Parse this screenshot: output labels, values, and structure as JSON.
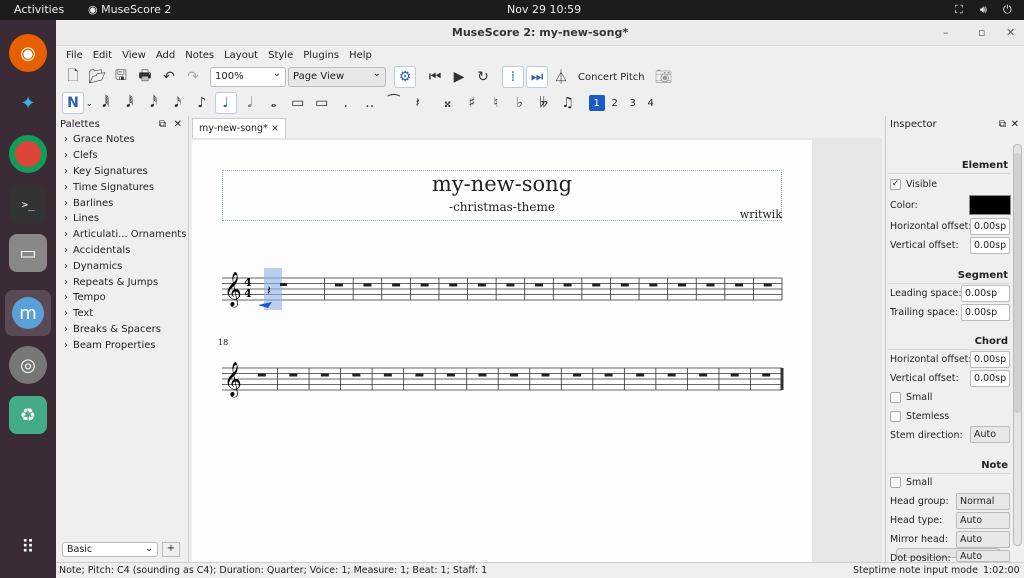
{
  "topbar": {
    "activities": "Activities",
    "app": "MuseScore 2",
    "clock": "Nov 29  10:59",
    "icons": [
      "network-icon",
      "volume-icon",
      "power-icon"
    ]
  },
  "dock": [
    "firefox-icon",
    "kodi-icon",
    "chrome-icon",
    "terminal-icon",
    "files-icon",
    "musescore-icon",
    "disc-icon",
    "trash-icon",
    "apps-grid-icon"
  ],
  "window": {
    "title": "MuseScore 2: my-new-song*"
  },
  "menu": [
    "File",
    "Edit",
    "View",
    "Add",
    "Notes",
    "Layout",
    "Style",
    "Plugins",
    "Help"
  ],
  "toolbar": {
    "zoom": "100%",
    "view_mode": "Page View",
    "concert_pitch": "Concert Pitch"
  },
  "voices": [
    "1",
    "2",
    "3",
    "4"
  ],
  "palettes": {
    "title": "Palettes",
    "items": [
      "Grace Notes",
      "Clefs",
      "Key Signatures",
      "Time Signatures",
      "Barlines",
      "Lines",
      "Articulati... Ornaments",
      "Accidentals",
      "Dynamics",
      "Repeats & Jumps",
      "Tempo",
      "Text",
      "Breaks & Spacers",
      "Beam Properties"
    ],
    "workspace": "Basic",
    "add": "+"
  },
  "tab": {
    "label": "my-new-song*",
    "close": "×"
  },
  "score": {
    "title": "my-new-song",
    "subtitle": "-christmas-theme",
    "composer": "writwik",
    "measure_number": "18",
    "time_sig_top": "4",
    "time_sig_bottom": "4"
  },
  "inspector": {
    "title": "Inspector",
    "element": {
      "header": "Element",
      "visible": "Visible",
      "visible_checked": true,
      "color_label": "Color:",
      "color": "#000000",
      "hoff_label": "Horizontal offset:",
      "hoff": "0.00sp",
      "voff_label": "Vertical offset:",
      "voff": "0.00sp"
    },
    "segment": {
      "header": "Segment",
      "leading_label": "Leading space:",
      "leading": "0.00sp",
      "trailing_label": "Trailing space:",
      "trailing": "0.00sp"
    },
    "chord": {
      "header": "Chord",
      "hoff_label": "Horizontal offset:",
      "hoff": "0.00sp",
      "voff_label": "Vertical offset:",
      "voff": "0.00sp",
      "small": "Small",
      "stemless": "Stemless",
      "stem_label": "Stem direction:",
      "stem": "Auto"
    },
    "note": {
      "header": "Note",
      "small": "Small",
      "head_group_label": "Head group:",
      "head_group": "Normal",
      "head_type_label": "Head type:",
      "head_type": "Auto",
      "mirror_label": "Mirror head:",
      "mirror": "Auto",
      "dot_label": "Dot position:",
      "dot": "Auto"
    }
  },
  "status": {
    "left": "Note; Pitch: C4 (sounding as C4); Duration: Quarter; Voice: 1; Measure: 1; Beat: 1; Staff: 1",
    "right": "Steptime note input mode",
    "time": "1:02:00"
  },
  "colors": {
    "accent": "#1a5bc4",
    "selection": "#8fb3e8"
  }
}
